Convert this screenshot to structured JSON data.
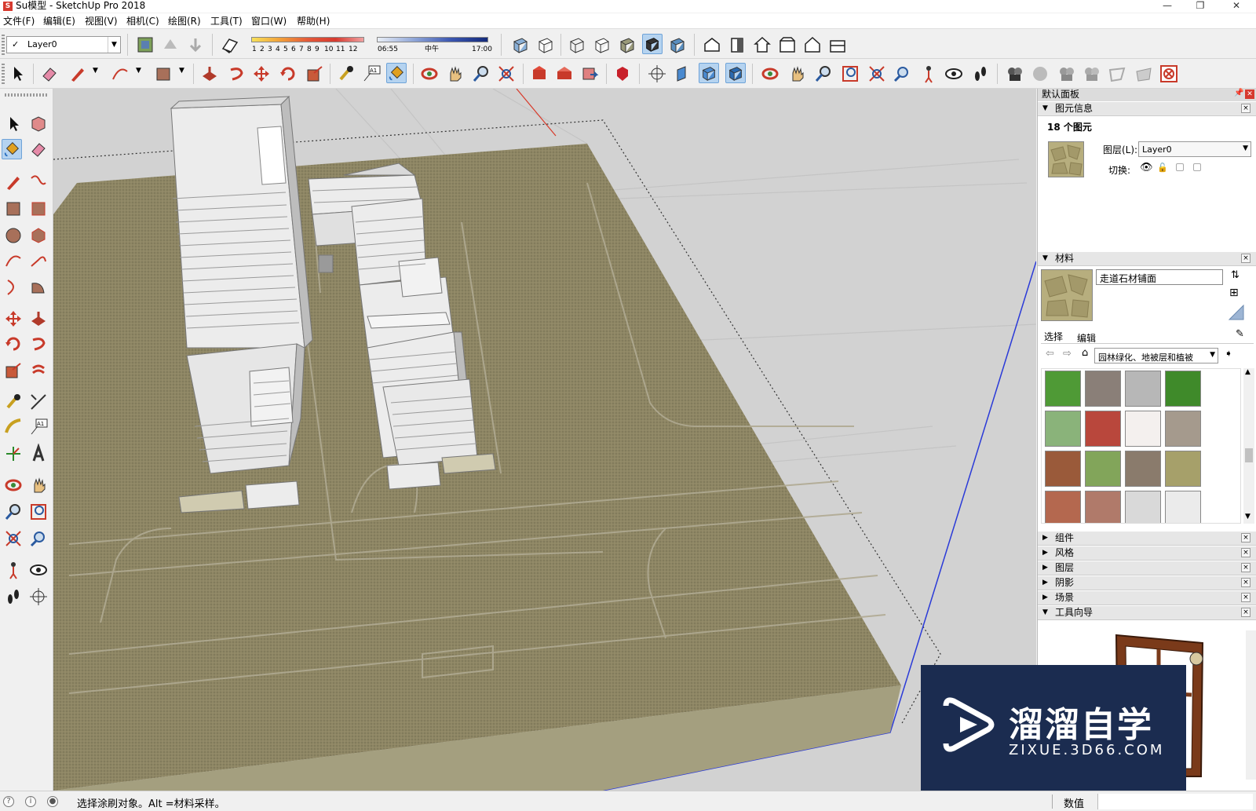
{
  "window": {
    "title": "Su模型 - SketchUp Pro 2018",
    "app_icon": "sketchup-icon",
    "controls": [
      "—",
      "❐",
      "✕"
    ]
  },
  "menu": [
    "文件(F)",
    "编辑(E)",
    "视图(V)",
    "相机(C)",
    "绘图(R)",
    "工具(T)",
    "窗口(W)",
    "帮助(H)"
  ],
  "toolbar": {
    "layer_value": "Layer0",
    "shadow_months": [
      "1",
      "2",
      "3",
      "4",
      "5",
      "6",
      "7",
      "8",
      "9",
      "10",
      "11",
      "12"
    ],
    "time_start": "06:55",
    "time_mid": "中午",
    "time_end": "17:00"
  },
  "right_panel": {
    "title": "默认面板",
    "entity_info": {
      "title": "图元信息",
      "count_text": "18 个图元",
      "layer_label": "图层(L):",
      "layer_value": "Layer0",
      "toggle_label": "切换:"
    },
    "materials": {
      "title": "材料",
      "name_value": "走道石材铺面",
      "tab_select": "选择",
      "tab_edit": "编辑",
      "library_value": "园林绿化、地被层和植被",
      "swatches": [
        {
          "color": "#4f9a36"
        },
        {
          "color": "#8a7f78"
        },
        {
          "color": "#b7b7b7"
        },
        {
          "color": "#3f8a2a"
        },
        {
          "color": "#8ab37a"
        },
        {
          "color": "#b9473c"
        },
        {
          "color": "#f4f0ee"
        },
        {
          "color": "#a59a8d"
        },
        {
          "color": "#9a5a3a"
        },
        {
          "color": "#82a55a"
        },
        {
          "color": "#8a7b6c"
        },
        {
          "color": "#a6a06a"
        },
        {
          "color": "#b4684f"
        },
        {
          "color": "#b07a6a"
        },
        {
          "color": "#d9d9d9"
        },
        {
          "color": "#ebebeb"
        }
      ]
    },
    "collapsed_sections": [
      "组件",
      "风格",
      "图层",
      "阴影",
      "场景"
    ],
    "instructor": {
      "title": "工具向导"
    }
  },
  "status": {
    "message": "选择涂刷对象。Alt =材料采样。",
    "measure_label": "数值"
  },
  "watermark": {
    "title": "溜溜自学",
    "subtitle": "ZIXUE.3D66.COM"
  }
}
